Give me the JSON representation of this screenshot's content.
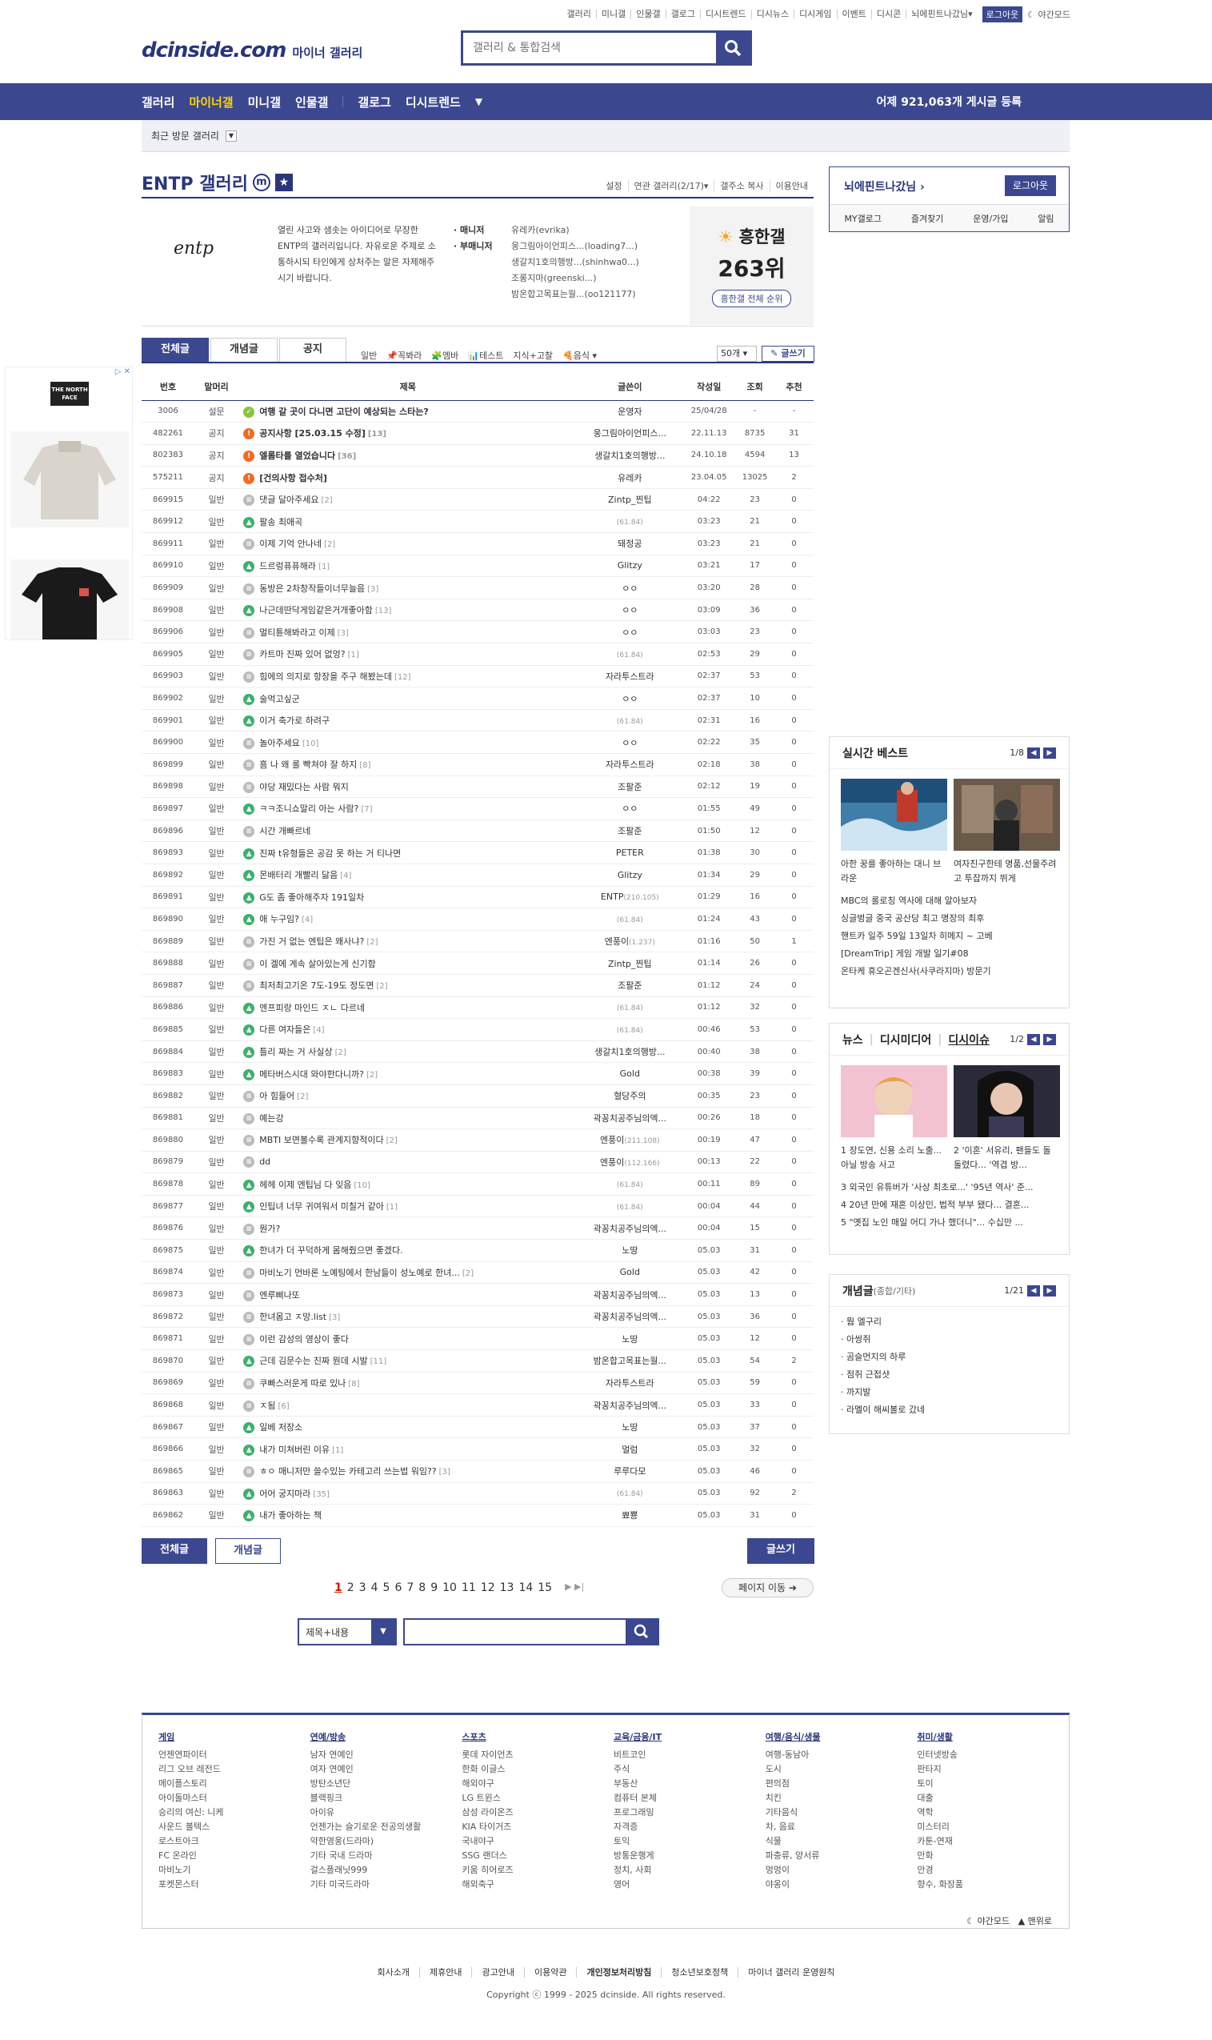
{
  "top_links": [
    "갤러리",
    "미니갤",
    "인물갤",
    "갤로그",
    "디시트렌드",
    "디시뉴스",
    "디시게임",
    "이벤트",
    "디시콘"
  ],
  "top_user": "뇌에핀트나갔님▾",
  "top_logout": "로그아웃",
  "top_night": "야간모드",
  "logo": {
    "main": "dcinside.com",
    "sub": "마이너 갤러리"
  },
  "search_placeholder": "갤러리 & 통합검색",
  "gnb": {
    "items": [
      "갤러리",
      "마이너갤",
      "미니갤",
      "인물갤",
      "갤로그",
      "디시트렌드"
    ],
    "count_prefix": "어제",
    "count_value": "921,063개",
    "count_suffix": "게시글 등록"
  },
  "recent_label": "최근 방문 갤러리",
  "gallery": {
    "title": "ENTP 갤러리",
    "m": "m",
    "menu": [
      "설정",
      "연관 갤러리(2/17)▾",
      "갤주소 복사",
      "이용안내"
    ],
    "logo_text": "entp",
    "desc": "열린 사고와 샘솟는 아이디어로 무장한 ENTP의 갤러리입니다. 자유로운 주제로 소통하시되 타인에게 상처주는 말은 자제해주시기 바랍니다.",
    "manager_label": "· 매니저",
    "submanager_label": "· 부매니저",
    "manager": "유레카(evrika)",
    "submanagers": [
      "웅그림아이언피스...(loading7...)",
      "생갈치1호의행방...(shinhwa0...)",
      "조롱지마(greenski...)",
      "밤온합고목표는월...(oo121177)"
    ],
    "hot_title": "흥한갤",
    "hot_rank": "263위",
    "hot_btn": "흥한갤 전체 순위"
  },
  "tabs": [
    "전체글",
    "개념글",
    "공지"
  ],
  "cats": [
    "일반",
    "꼭봐라",
    "엠바",
    "테스트",
    "지식+고찰",
    "음식"
  ],
  "sort": "50개",
  "write": "글쓰기",
  "columns": [
    "번호",
    "말머리",
    "제목",
    "글쓴이",
    "작성일",
    "조회",
    "추천"
  ],
  "rows": [
    {
      "num": "3006",
      "sub": "설문",
      "icon": "survey",
      "title": "여행 갈 곳이 다니면 고단이 예상되는 스타는?",
      "rep": "",
      "writer": "운영자",
      "ip": "",
      "date": "25/04/28",
      "view": "-",
      "rec": "-",
      "bold": true
    },
    {
      "num": "482261",
      "sub": "공지",
      "icon": "notice",
      "title": "공지사항 [25.03.15 수정]",
      "rep": "[13]",
      "writer": "웅그림아이언피스...",
      "ip": "",
      "date": "22.11.13",
      "view": "8735",
      "rec": "31",
      "bold": true
    },
    {
      "num": "802383",
      "sub": "공지",
      "icon": "notice",
      "title": "엘롬타를 열었습니다",
      "rep": "[36]",
      "writer": "생갈치1호의행방...",
      "ip": "",
      "date": "24.10.18",
      "view": "4594",
      "rec": "13",
      "bold": true
    },
    {
      "num": "575211",
      "sub": "공지",
      "icon": "notice",
      "title": "[건의사항 접수처]",
      "rep": "",
      "writer": "유레카",
      "ip": "",
      "date": "23.04.05",
      "view": "13025",
      "rec": "2",
      "bold": true
    },
    {
      "num": "869915",
      "sub": "일반",
      "icon": "txt",
      "title": "댓글 달아주세요",
      "rep": "[2]",
      "writer": "Zintp_찐팁",
      "ip": "",
      "date": "04:22",
      "view": "23",
      "rec": "0"
    },
    {
      "num": "869912",
      "sub": "일반",
      "icon": "img",
      "title": "팔송 최애곡",
      "rep": "",
      "writer": "",
      "ip": "(61.84)",
      "date": "03:23",
      "view": "21",
      "rec": "0"
    },
    {
      "num": "869911",
      "sub": "일반",
      "icon": "txt",
      "title": "이제 기억 안나네",
      "rep": "[2]",
      "writer": "돼정공",
      "ip": "",
      "date": "03:23",
      "view": "21",
      "rec": "0"
    },
    {
      "num": "869910",
      "sub": "일반",
      "icon": "img",
      "title": "드르렁퓨퓨해라",
      "rep": "[1]",
      "writer": "Glitzy",
      "ip": "",
      "date": "03:21",
      "view": "17",
      "rec": "0"
    },
    {
      "num": "869909",
      "sub": "일반",
      "icon": "txt",
      "title": "동방은 2차창작들이너무늘음",
      "rep": "[3]",
      "writer": "ㅇㅇ",
      "ip": "",
      "date": "03:20",
      "view": "28",
      "rec": "0"
    },
    {
      "num": "869908",
      "sub": "일반",
      "icon": "img",
      "title": "나근데딴닥게임같은거개좋아함",
      "rep": "[13]",
      "writer": "ㅇㅇ",
      "ip": "",
      "date": "03:09",
      "view": "36",
      "rec": "0"
    },
    {
      "num": "869906",
      "sub": "일반",
      "icon": "txt",
      "title": "멀티튠해봐라고 이제",
      "rep": "[3]",
      "writer": "ㅇㅇ",
      "ip": "",
      "date": "03:03",
      "view": "23",
      "rec": "0"
    },
    {
      "num": "869905",
      "sub": "일반",
      "icon": "txt",
      "title": "카트마 진짜 있어 없엉?",
      "rep": "[1]",
      "writer": "",
      "ip": "(61.84)",
      "date": "02:53",
      "view": "29",
      "rec": "0"
    },
    {
      "num": "869903",
      "sub": "일반",
      "icon": "txt",
      "title": "힘에의 의지로 항장을 주구 해봤는데",
      "rep": "[12]",
      "writer": "자라투스트라",
      "ip": "",
      "date": "02:37",
      "view": "53",
      "rec": "0"
    },
    {
      "num": "869902",
      "sub": "일반",
      "icon": "img",
      "title": "술먹고싶군",
      "rep": "",
      "writer": "ㅇㅇ",
      "ip": "",
      "date": "02:37",
      "view": "10",
      "rec": "0"
    },
    {
      "num": "869901",
      "sub": "일반",
      "icon": "img",
      "title": "이거 축가로 하려구",
      "rep": "",
      "writer": "",
      "ip": "(61.84)",
      "date": "02:31",
      "view": "16",
      "rec": "0"
    },
    {
      "num": "869900",
      "sub": "일반",
      "icon": "txt",
      "title": "놀아주세요",
      "rep": "[10]",
      "writer": "ㅇㅇ",
      "ip": "",
      "date": "02:22",
      "view": "35",
      "rec": "0"
    },
    {
      "num": "869899",
      "sub": "일반",
      "icon": "txt",
      "title": "흠 나 왜 롤 빡쳐야 잘 하지",
      "rep": "[8]",
      "writer": "자라투스트라",
      "ip": "",
      "date": "02:18",
      "view": "38",
      "rec": "0"
    },
    {
      "num": "869898",
      "sub": "일반",
      "icon": "txt",
      "title": "야당 재밌다는 사람 뭐지",
      "rep": "",
      "writer": "조팔준",
      "ip": "",
      "date": "02:12",
      "view": "19",
      "rec": "0"
    },
    {
      "num": "869897",
      "sub": "일반",
      "icon": "img",
      "title": "ㅋㅋ조니쇼말리 아는 사람?",
      "rep": "[7]",
      "writer": "ㅇㅇ",
      "ip": "",
      "date": "01:55",
      "view": "49",
      "rec": "0"
    },
    {
      "num": "869896",
      "sub": "일반",
      "icon": "txt",
      "title": "시간 개빠르네",
      "rep": "",
      "writer": "조팔준",
      "ip": "",
      "date": "01:50",
      "view": "12",
      "rec": "0"
    },
    {
      "num": "869893",
      "sub": "일반",
      "icon": "img",
      "title": "진짜 t유형들은 공감 못 하는 거 티나면",
      "rep": "",
      "writer": "PETER",
      "ip": "",
      "date": "01:38",
      "view": "30",
      "rec": "0"
    },
    {
      "num": "869892",
      "sub": "일반",
      "icon": "img",
      "title": "몬배터리 개빨리 닳음",
      "rep": "[4]",
      "writer": "Glitzy",
      "ip": "",
      "date": "01:34",
      "view": "29",
      "rec": "0"
    },
    {
      "num": "869891",
      "sub": "일반",
      "icon": "img",
      "title": "G도 좀 좋아해주자 191일차",
      "rep": "",
      "writer": "ENTP",
      "ip": "(210.105)",
      "date": "01:29",
      "view": "16",
      "rec": "0"
    },
    {
      "num": "869890",
      "sub": "일반",
      "icon": "img",
      "title": "애 누구임?",
      "rep": "[4]",
      "writer": "",
      "ip": "(61.84)",
      "date": "01:24",
      "view": "43",
      "rec": "0"
    },
    {
      "num": "869889",
      "sub": "일반",
      "icon": "txt",
      "title": "가진 거 없는 엔팁은 왜사냐?",
      "rep": "[2]",
      "writer": "엔풍이",
      "ip": "(1.237)",
      "date": "01:16",
      "view": "50",
      "rec": "1"
    },
    {
      "num": "869888",
      "sub": "일반",
      "icon": "txt",
      "title": "이 겔에 계속 살아있는게 신기함",
      "rep": "",
      "writer": "Zintp_찐팁",
      "ip": "",
      "date": "01:14",
      "view": "26",
      "rec": "0"
    },
    {
      "num": "869887",
      "sub": "일반",
      "icon": "txt",
      "title": "최저최고기온 7도-19도 정도면",
      "rep": "[2]",
      "writer": "조팔준",
      "ip": "",
      "date": "01:12",
      "view": "24",
      "rec": "0"
    },
    {
      "num": "869886",
      "sub": "일반",
      "icon": "img",
      "title": "엔프피랑 마인드 ㅈㄴ 다르네",
      "rep": "",
      "writer": "",
      "ip": "(61.84)",
      "date": "01:12",
      "view": "32",
      "rec": "0"
    },
    {
      "num": "869885",
      "sub": "일반",
      "icon": "img",
      "title": "다른 여자들은",
      "rep": "[4]",
      "writer": "",
      "ip": "(61.84)",
      "date": "00:46",
      "view": "53",
      "rec": "0"
    },
    {
      "num": "869884",
      "sub": "일반",
      "icon": "img",
      "title": "틀리 짜는 거 사실상",
      "rep": "[2]",
      "writer": "생갈치1호의행방...",
      "ip": "",
      "date": "00:40",
      "view": "38",
      "rec": "0"
    },
    {
      "num": "869883",
      "sub": "일반",
      "icon": "img",
      "title": "메타버스시대 와야한다니까?",
      "rep": "[2]",
      "writer": "Gold",
      "ip": "",
      "date": "00:38",
      "view": "39",
      "rec": "0"
    },
    {
      "num": "869882",
      "sub": "일반",
      "icon": "txt",
      "title": "아 힘들어",
      "rep": "[2]",
      "writer": "혈당주의",
      "ip": "",
      "date": "00:35",
      "view": "23",
      "rec": "0"
    },
    {
      "num": "869881",
      "sub": "일반",
      "icon": "txt",
      "title": "예는강",
      "rep": "",
      "writer": "곽꽁치공주님의엑...",
      "ip": "",
      "date": "00:26",
      "view": "18",
      "rec": "0"
    },
    {
      "num": "869880",
      "sub": "일반",
      "icon": "txt",
      "title": "MBTI 보면볼수록 관계지향적이다",
      "rep": "[2]",
      "writer": "엔풍이",
      "ip": "(211.108)",
      "date": "00:19",
      "view": "47",
      "rec": "0"
    },
    {
      "num": "869879",
      "sub": "일반",
      "icon": "txt",
      "title": "dd",
      "rep": "",
      "writer": "엔풍이",
      "ip": "(112.166)",
      "date": "00:13",
      "view": "22",
      "rec": "0"
    },
    {
      "num": "869878",
      "sub": "일반",
      "icon": "img",
      "title": "헤헤 이제 엔팁님 다 잊음",
      "rep": "[10]",
      "writer": "",
      "ip": "(61.84)",
      "date": "00:11",
      "view": "89",
      "rec": "0"
    },
    {
      "num": "869877",
      "sub": "일반",
      "icon": "img",
      "title": "인팁녀 너무 귀여워서 미칠거 같아",
      "rep": "[1]",
      "writer": "",
      "ip": "(61.84)",
      "date": "00:04",
      "view": "44",
      "rec": "0"
    },
    {
      "num": "869876",
      "sub": "일반",
      "icon": "txt",
      "title": "뭔가?",
      "rep": "",
      "writer": "곽꽁치공주님의엑...",
      "ip": "",
      "date": "00:04",
      "view": "15",
      "rec": "0"
    },
    {
      "num": "869875",
      "sub": "일반",
      "icon": "img",
      "title": "한녀가 더 꾸덕하게 몸해줬으면 좋겠다.",
      "rep": "",
      "writer": "노땅",
      "ip": "",
      "date": "05.03",
      "view": "31",
      "rec": "0"
    },
    {
      "num": "869874",
      "sub": "일반",
      "icon": "txt",
      "title": "마비노기 먼바론 노예팅에서 한남들이 성노예로 한녀...",
      "rep": "[2]",
      "writer": "Gold",
      "ip": "",
      "date": "05.03",
      "view": "42",
      "rec": "0"
    },
    {
      "num": "869873",
      "sub": "일반",
      "icon": "txt",
      "title": "엔루삐나또",
      "rep": "",
      "writer": "곽꽁치공주님의엑...",
      "ip": "",
      "date": "05.03",
      "view": "13",
      "rec": "0"
    },
    {
      "num": "869872",
      "sub": "일반",
      "icon": "txt",
      "title": "한녀몸고 ㅈ망.list",
      "rep": "[3]",
      "writer": "곽꽁치공주님의엑...",
      "ip": "",
      "date": "05.03",
      "view": "36",
      "rec": "0"
    },
    {
      "num": "869871",
      "sub": "일반",
      "icon": "txt",
      "title": "이런 감성의 영상이 좋다",
      "rep": "",
      "writer": "노땅",
      "ip": "",
      "date": "05.03",
      "view": "12",
      "rec": "0"
    },
    {
      "num": "869870",
      "sub": "일반",
      "icon": "img",
      "title": "근데 김문수는 진짜 뭔데 시발",
      "rep": "[11]",
      "writer": "밤온합고목표는월...",
      "ip": "",
      "date": "05.03",
      "view": "54",
      "rec": "2"
    },
    {
      "num": "869869",
      "sub": "일반",
      "icon": "txt",
      "title": "쿠빠스러운게 따로 있나",
      "rep": "[8]",
      "writer": "자라투스트라",
      "ip": "",
      "date": "05.03",
      "view": "59",
      "rec": "0"
    },
    {
      "num": "869868",
      "sub": "일반",
      "icon": "txt",
      "title": "ㅈ됨",
      "rep": "[6]",
      "writer": "곽꽁치공주님의엑...",
      "ip": "",
      "date": "05.03",
      "view": "33",
      "rec": "0"
    },
    {
      "num": "869867",
      "sub": "일반",
      "icon": "img",
      "title": "일베 저장소",
      "rep": "",
      "writer": "노땅",
      "ip": "",
      "date": "05.03",
      "view": "37",
      "rec": "0"
    },
    {
      "num": "869866",
      "sub": "일반",
      "icon": "img",
      "title": "내가 미쳐버린 이유",
      "rep": "[1]",
      "writer": "멀럼",
      "ip": "",
      "date": "05.03",
      "view": "32",
      "rec": "0"
    },
    {
      "num": "869865",
      "sub": "일반",
      "icon": "txt",
      "title": "ㅎㅇ 매니저만 쓸수있는 카테고리 쓰는법 워임??",
      "rep": "[3]",
      "writer": "루루다모",
      "ip": "",
      "date": "05.03",
      "view": "46",
      "rec": "0"
    },
    {
      "num": "869863",
      "sub": "일반",
      "icon": "img",
      "title": "어어 궁지마라",
      "rep": "[35]",
      "writer": "",
      "ip": "(61.84)",
      "date": "05.03",
      "view": "92",
      "rec": "2"
    },
    {
      "num": "869862",
      "sub": "일반",
      "icon": "img",
      "title": "내가 좋아하는 책",
      "rep": "",
      "writer": "뾰뿅",
      "ip": "",
      "date": "05.03",
      "view": "31",
      "rec": "0"
    }
  ],
  "bottom": {
    "all": "전체글",
    "concept": "개념글",
    "write": "글쓰기"
  },
  "pages": [
    "1",
    "2",
    "3",
    "4",
    "5",
    "6",
    "7",
    "8",
    "9",
    "10",
    "11",
    "12",
    "13",
    "14",
    "15"
  ],
  "page_move": "페이지 이동",
  "search_type": "제목+내용",
  "login": {
    "name": "뇌에핀트나갔님",
    "logout": "로그아웃",
    "links": [
      "MY갤로그",
      "즐겨찾기",
      "운영/가입",
      "알림"
    ]
  },
  "best": {
    "title": "실시간 베스트",
    "page": "1/8",
    "thumbs": [
      "아한 꿍를 좋아하는 대니 브라운",
      "여자친구한테 명품,선물주려고 투잡까지 뛰게"
    ],
    "list": [
      "MBC의 롤로칭 역사에 대해 알아보자",
      "싱글벙글 중국 공산당 최고 명장의 최후",
      "핸트카 일주 59일 13일차 히메지 ~ 고베",
      "[DreamTrip] 게임 개발 일기#08",
      "온타케 휴오곤겐신사(사쿠라지마) 방문기"
    ]
  },
  "news": {
    "tabs": [
      "뉴스",
      "디시미디어",
      "디시이슈"
    ],
    "page": "1/2",
    "thumbs": [
      "1 장도연, 신용 소리 노출... 아닐 방송 사고",
      "2 '이혼' 서유리, 팬들도 돌 돌렸다... '역겹 방..."
    ],
    "list": [
      "3 외국인 유튜버가 '사상 최초로...' '95년 역사' 준...",
      "4 20년 만에 재혼 이상민, 법적 부부 됐다... 결혼...",
      "5 \"옛집 노인 매일 어디 가나 했더니\"... 수십만 ..."
    ]
  },
  "concept": {
    "title": "개념글",
    "sub": "(종합/기타)",
    "page": "1/21",
    "list": [
      "· 뭠 엘구리",
      "· 아쌍쥐",
      "· 곰슬먼지의 하루",
      "· 점쥐 근접샷",
      "· 까지발",
      "· 라멜이 해씨볼로 갔네"
    ]
  },
  "footer": {
    "cols": [
      {
        "h": "게임",
        "items": [
          "언젠연파이터",
          "리그 오브 레전드",
          "메이플스토리",
          "아이돌마스터",
          "승리의 여신: 니케",
          "사운드 볼텍스",
          "로스트아크",
          "FC 온라인",
          "마비노기",
          "포켓몬스터"
        ]
      },
      {
        "h": "연예/방송",
        "items": [
          "남자 연예인",
          "여자 연예인",
          "방탄소년단",
          "블랙핑크",
          "아이유",
          "언젠가는 슬기로운 전공의생활",
          "약한영웅(드라마)",
          "기타 국내 드라마",
          "걸스플래닛999",
          "기타 미국드라마"
        ]
      },
      {
        "h": "스포츠",
        "items": [
          "롯데 자이언츠",
          "한화 이글스",
          "해외야구",
          "LG 트윈스",
          "삼성 라이온즈",
          "KIA 타이거즈",
          "국내야구",
          "SSG 랜더스",
          "키움 히어로즈",
          "해외축구"
        ]
      },
      {
        "h": "교육/금융/IT",
        "items": [
          "비트코인",
          "주식",
          "부동산",
          "컴퓨터 본체",
          "프로그래밍",
          "자격증",
          "토익",
          "방통운행게",
          "정치, 사회",
          "영어"
        ]
      },
      {
        "h": "여행/음식/생물",
        "items": [
          "여행-동남아",
          "도시",
          "편의점",
          "치킨",
          "기타음식",
          "차, 음료",
          "식물",
          "파충류, 양서류",
          "멍멍이",
          "야옹이"
        ]
      },
      {
        "h": "취미/생활",
        "items": [
          "인터넷방송",
          "판타지",
          "토이",
          "대출",
          "역학",
          "미스터리",
          "카툰-연재",
          "만화",
          "안경",
          "향수, 화장품"
        ]
      }
    ],
    "mode": [
      "야간모드",
      "맨위로"
    ],
    "links": [
      "회사소개",
      "제휴안내",
      "광고안내",
      "이용약관",
      "개인정보처리방침",
      "청소년보호정책",
      "마이너 갤러리 운영원칙"
    ],
    "copy": "Copyright ⓒ 1999 - 2025 dcinside. All rights reserved."
  },
  "ad_brand": "THE NORTH FACE"
}
